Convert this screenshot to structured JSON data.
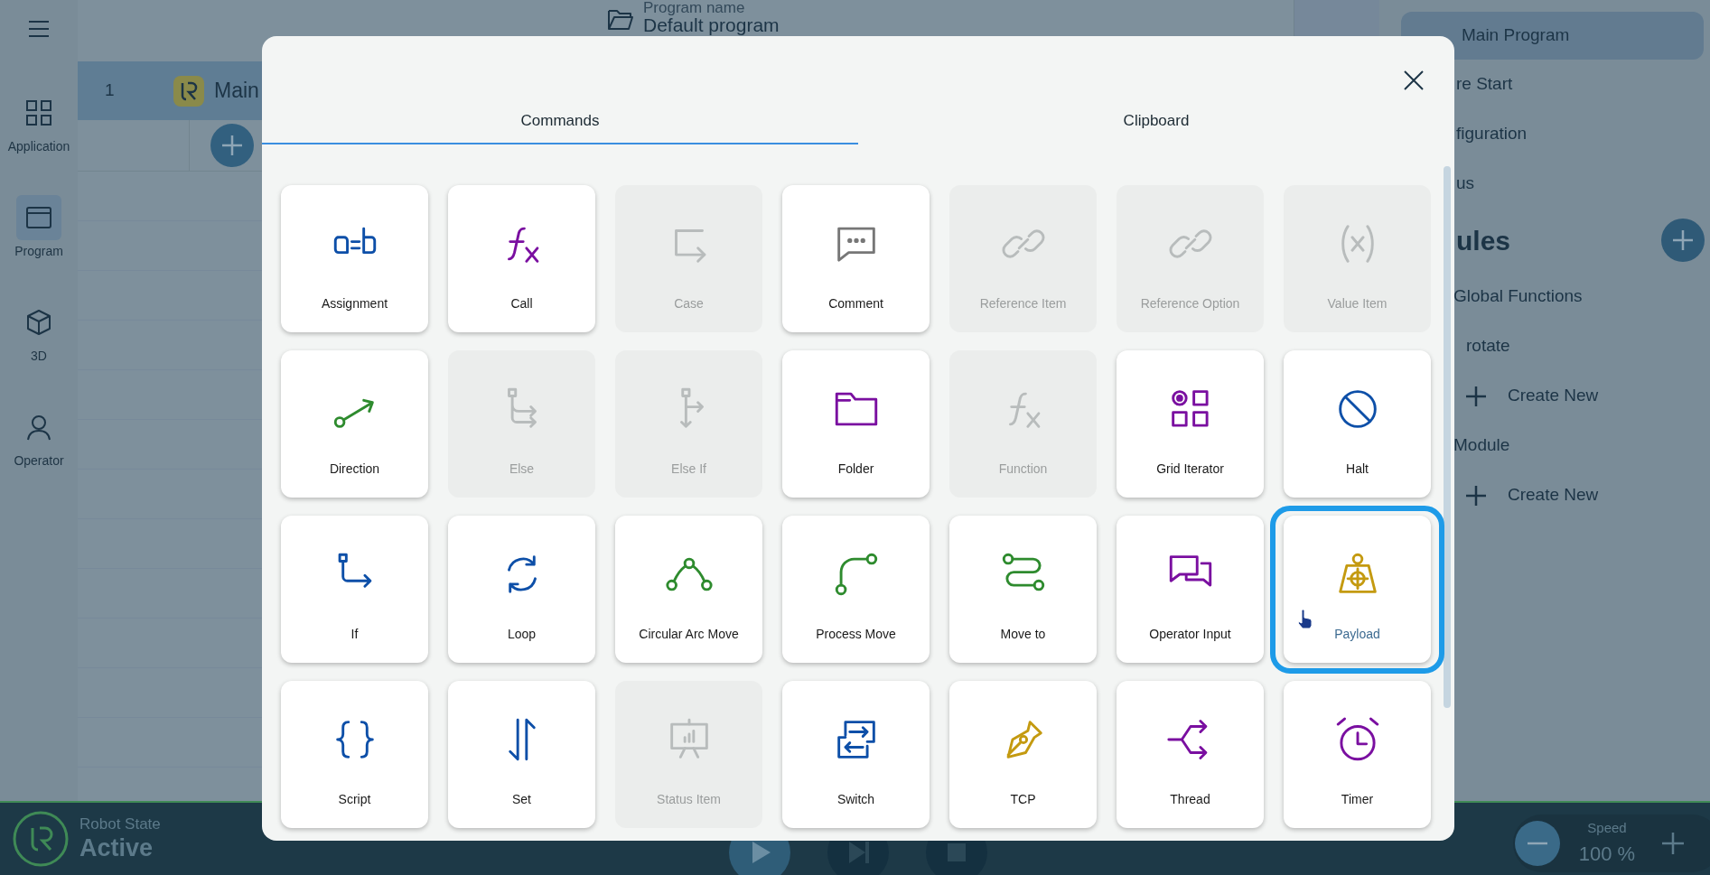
{
  "nav": [
    {
      "label": "Application",
      "selected": false
    },
    {
      "label": "Program",
      "selected": true
    },
    {
      "label": "3D",
      "selected": false
    },
    {
      "label": "Operator",
      "selected": false
    }
  ],
  "header": {
    "label": "Program name",
    "value": "Default program"
  },
  "program_rows": [
    {
      "number": "1",
      "label": "Main",
      "selected": true
    }
  ],
  "side_panel": {
    "items": [
      {
        "label": "Main Program",
        "selected": true
      },
      {
        "label": "re Start",
        "selected": false
      },
      {
        "label": "figuration",
        "selected": false
      },
      {
        "label": "us",
        "selected": false
      }
    ],
    "section_title": "ules",
    "tree": [
      {
        "label": "Global Functions",
        "children": [
          {
            "label": "rotate",
            "kind": "item"
          },
          {
            "label": "Create New",
            "kind": "create"
          }
        ]
      },
      {
        "label": "Module",
        "children": [
          {
            "label": "Create New",
            "kind": "create"
          }
        ]
      }
    ]
  },
  "status_bar": {
    "label": "Robot State",
    "state": "Active",
    "speed_label": "Speed",
    "speed": "100 %"
  },
  "dialog": {
    "tabs": [
      {
        "label": "Commands",
        "selected": true
      },
      {
        "label": "Clipboard",
        "selected": false
      }
    ],
    "commands": [
      {
        "label": "Assignment",
        "disabled": false,
        "selected": false,
        "color": "#0d4fa8"
      },
      {
        "label": "Call",
        "disabled": false,
        "selected": false,
        "color": "#7a0fa0"
      },
      {
        "label": "Case",
        "disabled": true,
        "selected": false
      },
      {
        "label": "Comment",
        "disabled": false,
        "selected": false,
        "color": "#777777"
      },
      {
        "label": "Reference Item",
        "disabled": true,
        "selected": false
      },
      {
        "label": "Reference Option",
        "disabled": true,
        "selected": false
      },
      {
        "label": "Value Item",
        "disabled": true,
        "selected": false
      },
      {
        "label": "Direction",
        "disabled": false,
        "selected": false,
        "color": "#2e8b2e"
      },
      {
        "label": "Else",
        "disabled": true,
        "selected": false
      },
      {
        "label": "Else If",
        "disabled": true,
        "selected": false
      },
      {
        "label": "Folder",
        "disabled": false,
        "selected": false,
        "color": "#7a0fa0"
      },
      {
        "label": "Function",
        "disabled": true,
        "selected": false
      },
      {
        "label": "Grid Iterator",
        "disabled": false,
        "selected": false,
        "color": "#7a0fa0"
      },
      {
        "label": "Halt",
        "disabled": false,
        "selected": false,
        "color": "#0d4fa8"
      },
      {
        "label": "If",
        "disabled": false,
        "selected": false,
        "color": "#0d4fa8"
      },
      {
        "label": "Loop",
        "disabled": false,
        "selected": false,
        "color": "#0d4fa8"
      },
      {
        "label": "Circular Arc Move",
        "disabled": false,
        "selected": false,
        "color": "#2e8b2e"
      },
      {
        "label": "Process Move",
        "disabled": false,
        "selected": false,
        "color": "#2e8b2e"
      },
      {
        "label": "Move to",
        "disabled": false,
        "selected": false,
        "color": "#2e8b2e"
      },
      {
        "label": "Operator Input",
        "disabled": false,
        "selected": false,
        "color": "#7a0fa0"
      },
      {
        "label": "Payload",
        "disabled": false,
        "selected": true,
        "color": "#c49a10"
      },
      {
        "label": "Script",
        "disabled": false,
        "selected": false,
        "color": "#0d4fa8"
      },
      {
        "label": "Set",
        "disabled": false,
        "selected": false,
        "color": "#0d4fa8"
      },
      {
        "label": "Status Item",
        "disabled": true,
        "selected": false
      },
      {
        "label": "Switch",
        "disabled": false,
        "selected": false,
        "color": "#0d4fa8"
      },
      {
        "label": "TCP",
        "disabled": false,
        "selected": false,
        "color": "#c49a10"
      },
      {
        "label": "Thread",
        "disabled": false,
        "selected": false,
        "color": "#7a0fa0"
      },
      {
        "label": "Timer",
        "disabled": false,
        "selected": false,
        "color": "#7a0fa0"
      }
    ]
  }
}
